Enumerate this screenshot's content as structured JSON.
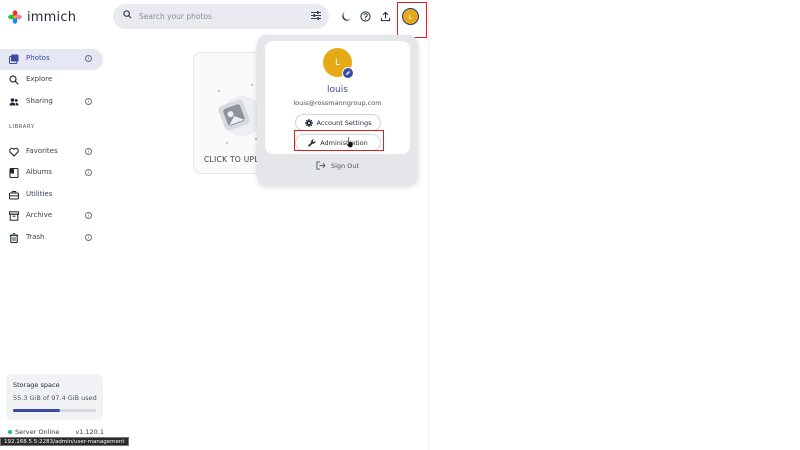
{
  "app": {
    "name": "immich"
  },
  "header": {
    "search_placeholder": "Search your photos",
    "icons": [
      "search-icon",
      "filter-icon",
      "moon-icon",
      "help-icon",
      "upload-icon"
    ],
    "avatar_initial": "L"
  },
  "sidebar": {
    "items": [
      {
        "label": "Photos",
        "icon": "photos-icon",
        "active": true,
        "info": true
      },
      {
        "label": "Explore",
        "icon": "search-icon",
        "active": false,
        "info": false
      },
      {
        "label": "Sharing",
        "icon": "people-icon",
        "active": false,
        "info": true
      }
    ],
    "library_label": "LIBRARY",
    "library_items": [
      {
        "label": "Favorites",
        "icon": "heart-icon",
        "info": true
      },
      {
        "label": "Albums",
        "icon": "album-icon",
        "info": true
      },
      {
        "label": "Utilities",
        "icon": "toolbox-icon",
        "info": false
      },
      {
        "label": "Archive",
        "icon": "archive-icon",
        "info": true
      },
      {
        "label": "Trash",
        "icon": "trash-icon",
        "info": true
      }
    ],
    "storage": {
      "title": "Storage space",
      "usage": "55.3 GiB of 97.4 GiB used",
      "used_fraction": 0.568
    },
    "server": {
      "status": "Server Online",
      "version": "v1.120.1"
    }
  },
  "main": {
    "upload_text": "CLICK TO UPLO"
  },
  "account_menu": {
    "avatar_initial": "L",
    "name": "louis",
    "email": "louis@rossmanngroup.com",
    "account_settings": "Account Settings",
    "administration": "Administration",
    "sign_out": "Sign Out"
  },
  "status_url": "192.168.5.5:2283/admin/user-management",
  "colors": {
    "accent": "#3b4aa3",
    "avatar": "#e6aa17",
    "highlight": "#e11d1d"
  }
}
